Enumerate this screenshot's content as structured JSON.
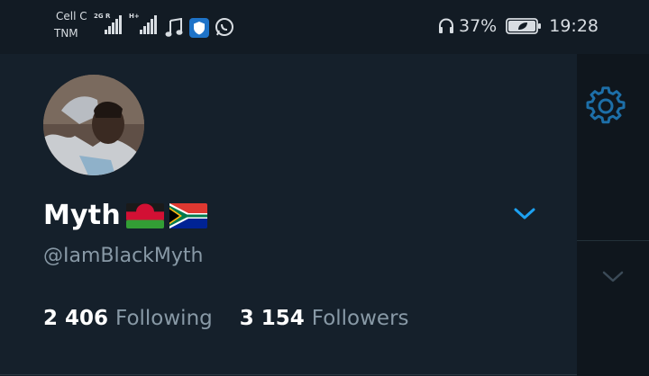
{
  "status_bar": {
    "carrier_1": "Cell C",
    "carrier_2": "TNM",
    "net_1": "2G R",
    "net_2": "H+",
    "battery": "37%",
    "time": "19:28",
    "icons": [
      "signal-icon",
      "music-note-icon",
      "shield-app-icon",
      "whatsapp-icon",
      "headphones-icon",
      "battery-icon"
    ]
  },
  "profile": {
    "name": "Myth",
    "flags": [
      "malawi-flag",
      "south-africa-flag"
    ],
    "handle": "@IamBlackMyth",
    "following_count": "2 406",
    "following_label": "Following",
    "followers_count": "3 154",
    "followers_label": "Followers"
  },
  "colors": {
    "background": "#15202b",
    "accent": "#1da1f2",
    "secondary_text": "#8899a6"
  }
}
